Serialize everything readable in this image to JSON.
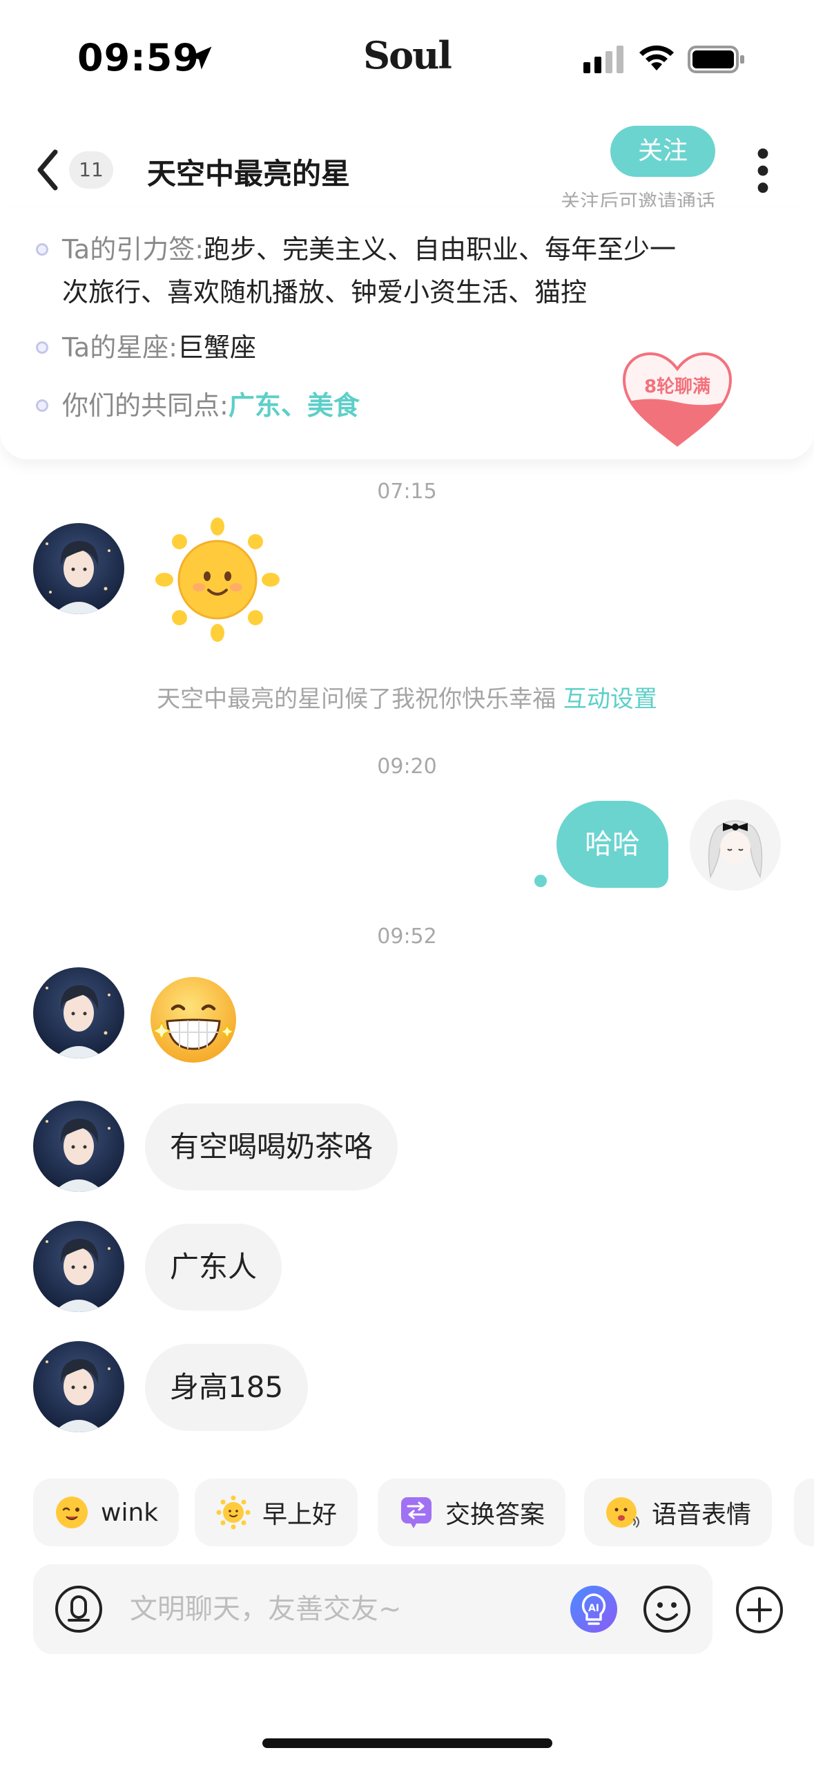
{
  "status_bar": {
    "time": "09:59",
    "app_name": "Soul"
  },
  "header": {
    "unread_count": "11",
    "title": "天空中最亮的星",
    "follow_label": "关注",
    "follow_hint": "关注后可邀请通话"
  },
  "profile": {
    "tags_label": "Ta的引力签:",
    "tags_line1": "跑步、完美主义、自由职业、每年至少一",
    "tags_line2": "次旅行、喜欢随机播放、钟爱小资生活、猫控",
    "zodiac_label": "Ta的星座:",
    "zodiac_value": "巨蟹座",
    "common_label": "你们的共同点:",
    "common_value": "广东、美食",
    "heart_badge": "8轮聊满"
  },
  "messages": {
    "time1": "07:15",
    "greeting_text": "天空中最亮的星问候了我祝你快乐幸福",
    "greeting_link": "互动设置",
    "time2": "09:20",
    "sent_text": "哈哈",
    "time3": "09:52",
    "msg1": "有空喝喝奶茶咯",
    "msg2": "广东人",
    "msg3": "身高185"
  },
  "quick_replies": [
    {
      "label": "wink",
      "icon": "wink-emoji-icon"
    },
    {
      "label": "早上好",
      "icon": "sun-icon"
    },
    {
      "label": "交换答案",
      "icon": "exchange-icon"
    },
    {
      "label": "语音表情",
      "icon": "voice-emoji-icon"
    }
  ],
  "input": {
    "placeholder": "文明聊天，友善交友~"
  },
  "colors": {
    "accent": "#6bd4cf",
    "bubble_in": "#f3f3f3",
    "muted_text": "#a8a8a8",
    "heart": "#f2727c"
  }
}
